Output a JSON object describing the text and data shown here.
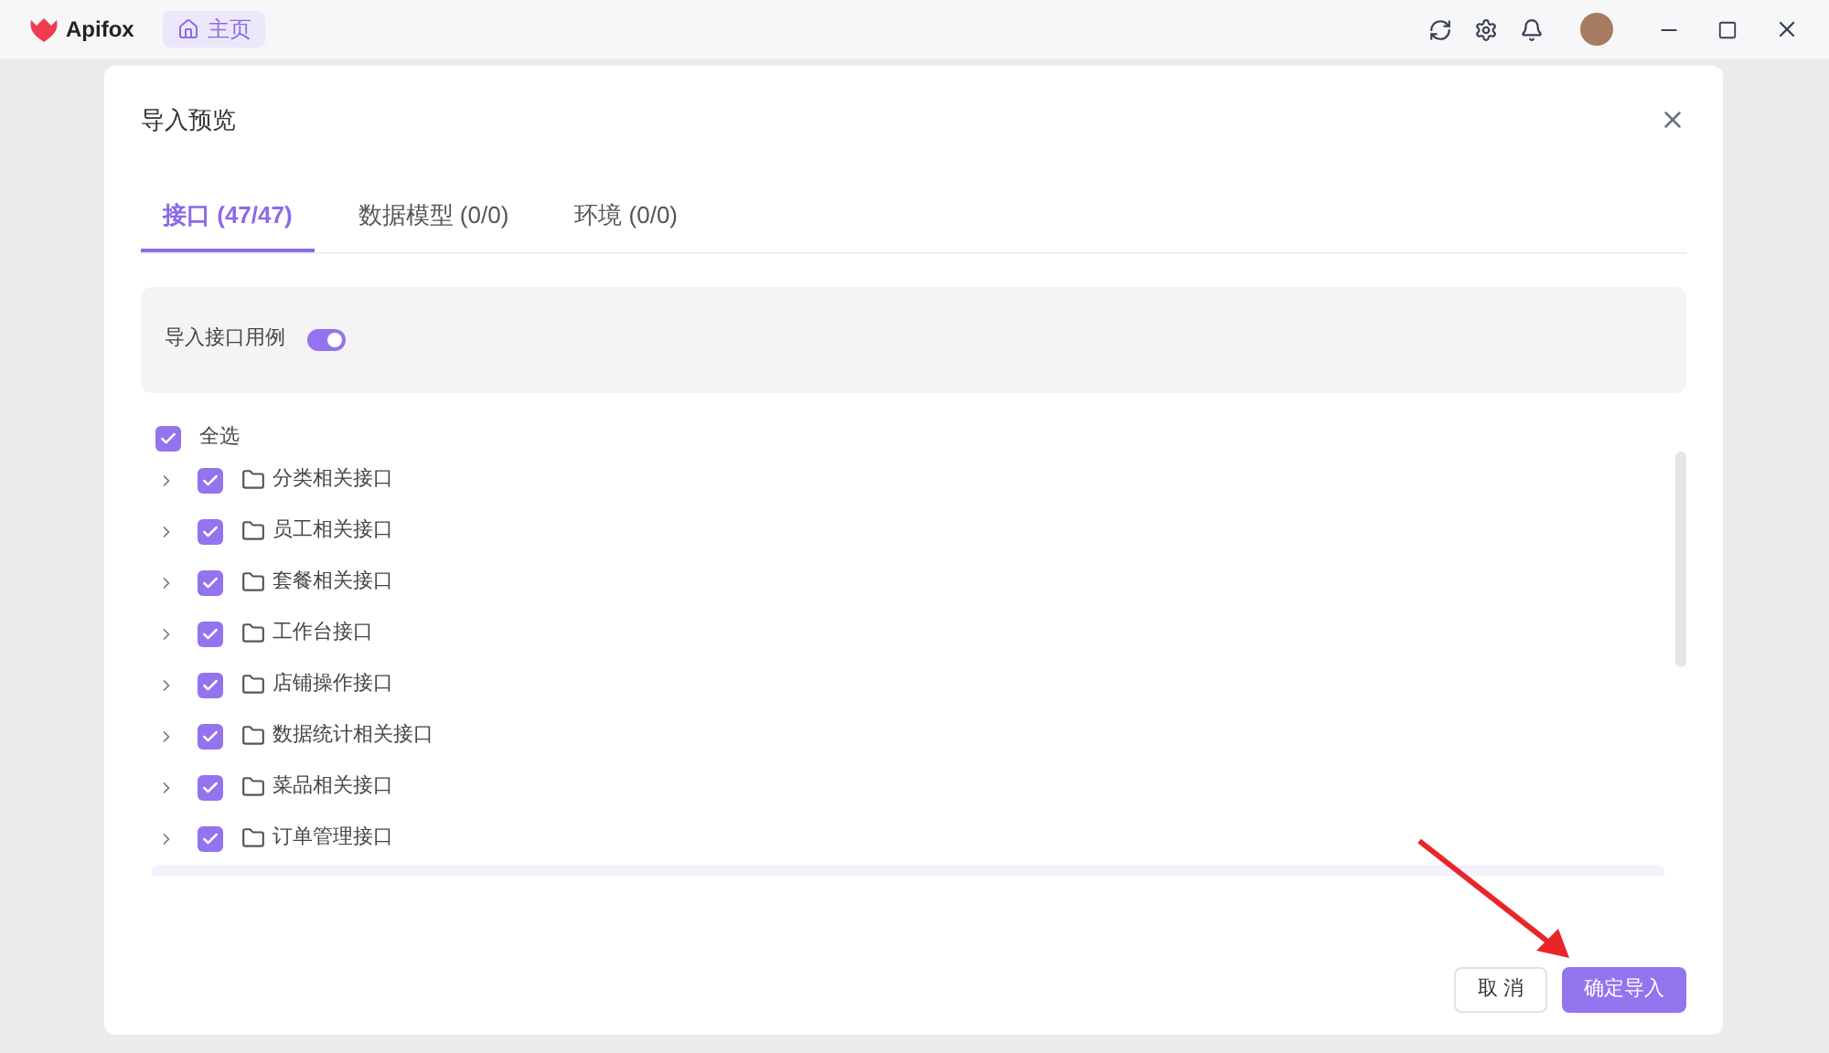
{
  "app": {
    "name": "Apifox",
    "home_tab": {
      "label": "主页",
      "selected": true
    }
  },
  "dialog": {
    "title": "导入预览",
    "tabs": [
      {
        "label": "接口 (47/47)",
        "selected": true
      },
      {
        "label": "数据模型 (0/0)",
        "selected": false
      },
      {
        "label": "环境 (0/0)",
        "selected": false
      }
    ],
    "option": {
      "label": "导入接口用例",
      "on": true
    },
    "select_all": {
      "label": "全选",
      "checked": true
    },
    "items": [
      {
        "name": "分类相关接口",
        "checked": true,
        "expanded": false
      },
      {
        "name": "员工相关接口",
        "checked": true,
        "expanded": false
      },
      {
        "name": "套餐相关接口",
        "checked": true,
        "expanded": false
      },
      {
        "name": "工作台接口",
        "checked": true,
        "expanded": false
      },
      {
        "name": "店铺操作接口",
        "checked": true,
        "expanded": false
      },
      {
        "name": "数据统计相关接口",
        "checked": true,
        "expanded": false
      },
      {
        "name": "菜品相关接口",
        "checked": true,
        "expanded": false
      },
      {
        "name": "订单管理接口",
        "checked": true,
        "expanded": false
      }
    ],
    "buttons": [
      {
        "label": "取 消",
        "kind": "secondary"
      },
      {
        "label": "确定导入",
        "kind": "primary"
      }
    ]
  }
}
